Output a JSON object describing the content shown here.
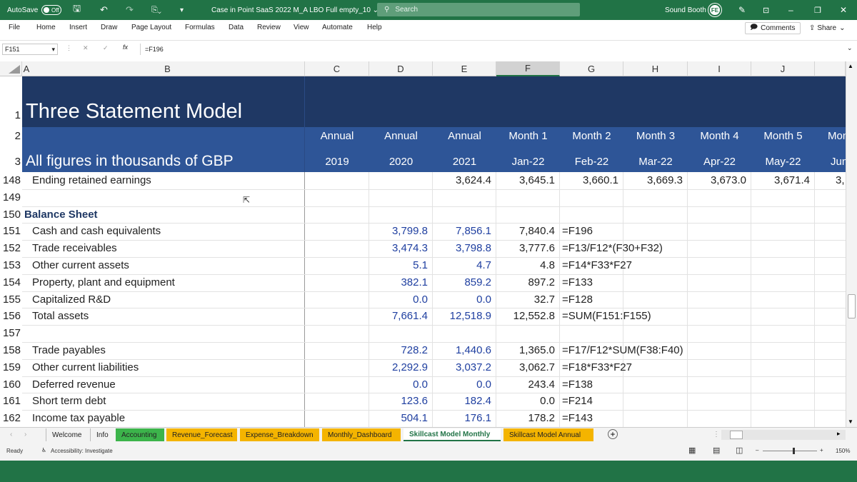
{
  "window": {
    "autosave_label": "AutoSave",
    "autosave_state": "Off",
    "file_title": "Case in Point SaaS 2022 M_A LBO Full empty_10 ⌄",
    "search_placeholder": "Search",
    "user_name": "Sound Booth",
    "user_initials": "FE",
    "accent_color": "#217346"
  },
  "menu": {
    "items": [
      "File",
      "Home",
      "Insert",
      "Draw",
      "Page Layout",
      "Formulas",
      "Data",
      "Review",
      "View",
      "Automate",
      "Help"
    ],
    "comments_label": "Comments",
    "share_label": "Share"
  },
  "formula_bar": {
    "name_box": "F151",
    "fx": "fx",
    "formula": "=F196"
  },
  "columns": [
    "A",
    "B",
    "C",
    "D",
    "E",
    "F",
    "G",
    "H",
    "I",
    "J"
  ],
  "sheet": {
    "title": "Three Statement Model",
    "subtitle": "All figures in thousands of GBP",
    "period_types": [
      "Annual",
      "Annual",
      "Annual",
      "Month 1",
      "Month 2",
      "Month 3",
      "Month 4",
      "Month 5",
      "Mon"
    ],
    "period_labels": [
      "2019",
      "2020",
      "2021",
      "Jan-22",
      "Feb-22",
      "Mar-22",
      "Apr-22",
      "May-22",
      "Jun"
    ],
    "header_colors": {
      "title_band": "#1f3864",
      "period_band": "#2e5597"
    },
    "header_row_numbers": [
      "1",
      "2",
      "3"
    ],
    "rows": [
      {
        "num": "148",
        "label": "Ending retained earnings",
        "c": "",
        "d": "",
        "e": "3,624.4",
        "f": "3,645.1",
        "g": "3,660.1",
        "h": "3,669.3",
        "i": "3,673.0",
        "j": "3,671.4",
        "k": "3,"
      },
      {
        "num": "149",
        "label": "",
        "c": "",
        "d": "",
        "e": "",
        "f": "",
        "g": "",
        "h": "",
        "i": "",
        "j": "",
        "k": ""
      },
      {
        "num": "150",
        "label": "Balance Sheet",
        "section": true,
        "c": "",
        "d": "",
        "e": "",
        "f": "",
        "g": "",
        "h": "",
        "i": "",
        "j": "",
        "k": ""
      },
      {
        "num": "151",
        "label": "Cash and cash equivalents",
        "c": "",
        "d": "3,799.8",
        "e": "7,856.1",
        "f": "7,840.4",
        "g": "=F196",
        "h": "",
        "i": "",
        "j": "",
        "k": ""
      },
      {
        "num": "152",
        "label": "Trade receivables",
        "c": "",
        "d": "3,474.3",
        "e": "3,798.8",
        "f": "3,777.6",
        "g": "=F13/F12*(F30+F32)",
        "h": "",
        "i": "",
        "j": "",
        "k": ""
      },
      {
        "num": "153",
        "label": "Other current assets",
        "c": "",
        "d": "5.1",
        "e": "4.7",
        "f": "4.8",
        "g": "=F14*F33*F27",
        "h": "",
        "i": "",
        "j": "",
        "k": ""
      },
      {
        "num": "154",
        "label": "Property, plant and equipment",
        "c": "",
        "d": "382.1",
        "e": "859.2",
        "f": "897.2",
        "g": "=F133",
        "h": "",
        "i": "",
        "j": "",
        "k": ""
      },
      {
        "num": "155",
        "label": "Capitalized R&D",
        "c": "",
        "d": "0.0",
        "e": "0.0",
        "f": "32.7",
        "g": "=F128",
        "h": "",
        "i": "",
        "j": "",
        "k": ""
      },
      {
        "num": "156",
        "label": "Total assets",
        "c": "",
        "d": "7,661.4",
        "e": "12,518.9",
        "f": "12,552.8",
        "g": "=SUM(F151:F155)",
        "h": "",
        "i": "",
        "j": "",
        "k": ""
      },
      {
        "num": "157",
        "label": "",
        "c": "",
        "d": "",
        "e": "",
        "f": "",
        "g": "",
        "h": "",
        "i": "",
        "j": "",
        "k": ""
      },
      {
        "num": "158",
        "label": "Trade payables",
        "c": "",
        "d": "728.2",
        "e": "1,440.6",
        "f": "1,365.0",
        "g": "=F17/F12*SUM(F38:F40)",
        "h": "",
        "i": "",
        "j": "",
        "k": ""
      },
      {
        "num": "159",
        "label": "Other current liabilities",
        "c": "",
        "d": "2,292.9",
        "e": "3,037.2",
        "f": "3,062.7",
        "g": "=F18*F33*F27",
        "h": "",
        "i": "",
        "j": "",
        "k": ""
      },
      {
        "num": "160",
        "label": "Deferred revenue",
        "c": "",
        "d": "0.0",
        "e": "0.0",
        "f": "243.4",
        "g": "=F138",
        "h": "",
        "i": "",
        "j": "",
        "k": ""
      },
      {
        "num": "161",
        "label": "Short term debt",
        "c": "",
        "d": "123.6",
        "e": "182.4",
        "f": "0.0",
        "g": "=F214",
        "h": "",
        "i": "",
        "j": "",
        "k": ""
      },
      {
        "num": "162",
        "label": "Income tax payable",
        "c": "",
        "d": "504.1",
        "e": "176.1",
        "f": "178.2",
        "g": "=F143",
        "h": "",
        "i": "",
        "j": "",
        "k": ""
      }
    ]
  },
  "tabs": [
    {
      "label": "Welcome",
      "color": ""
    },
    {
      "label": "Info",
      "color": ""
    },
    {
      "label": "Accounting",
      "color": "#3cb44b"
    },
    {
      "label": "Revenue_Forecast",
      "color": "#f4b400"
    },
    {
      "label": "Expense_Breakdown",
      "color": "#f4b400"
    },
    {
      "label": "Monthly_Dashboard",
      "color": "#f4b400"
    },
    {
      "label": "Skillcast Model Monthly",
      "color": "#ffffff",
      "active": true
    },
    {
      "label": "Skillcast Model Annual",
      "color": "#f4b400"
    }
  ],
  "status": {
    "ready": "Ready",
    "accessibility": "Accessibility: Investigate",
    "zoom": "150%"
  }
}
